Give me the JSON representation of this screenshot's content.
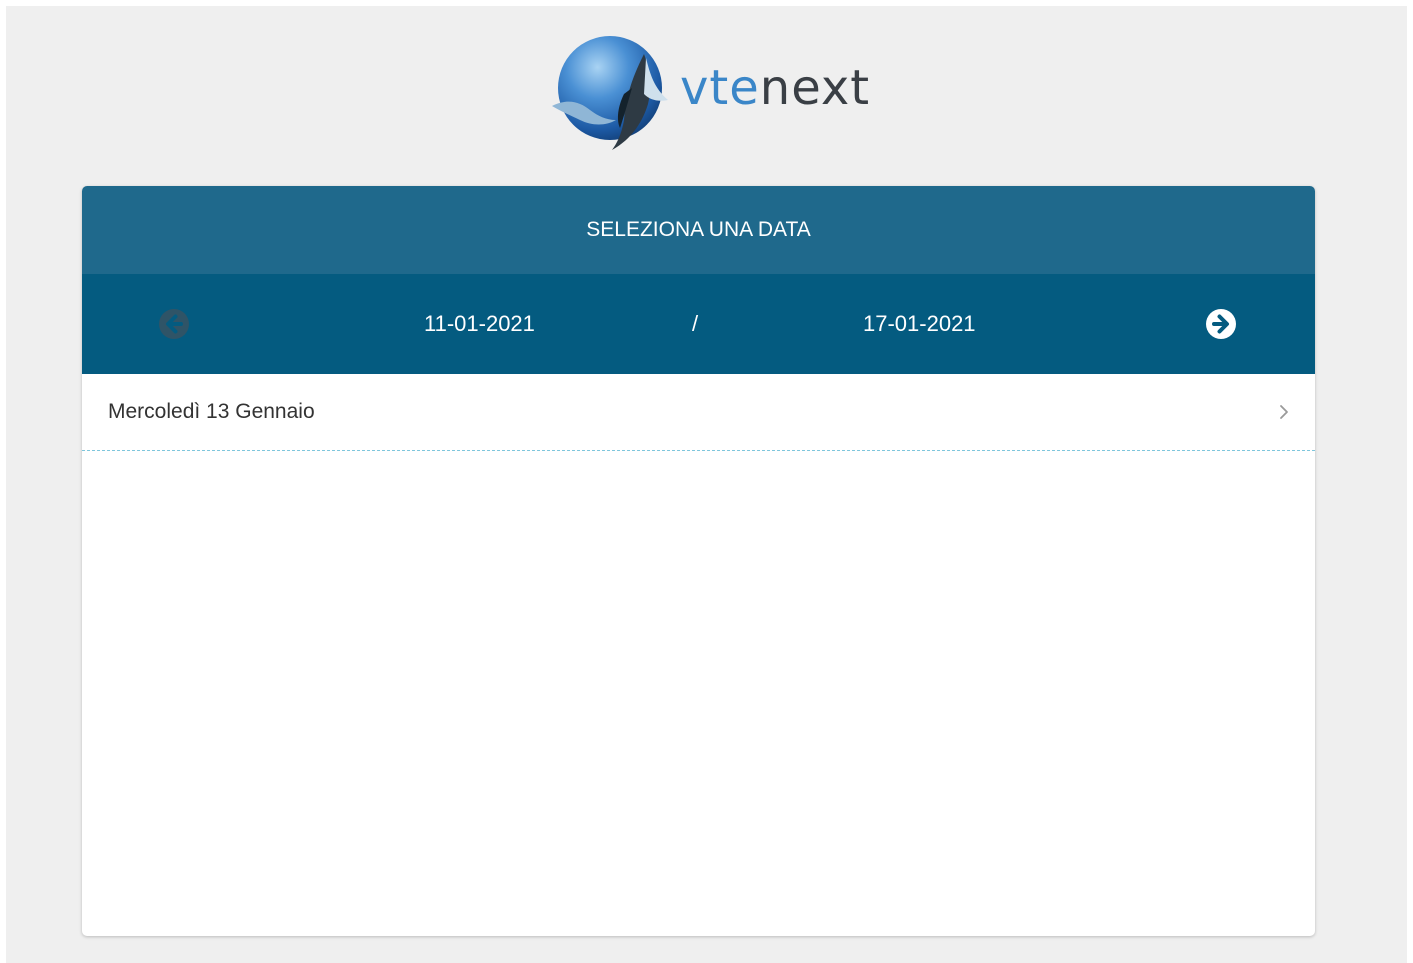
{
  "logo": {
    "text_part1": "vte",
    "text_part2": "next",
    "brand_colors": [
      "#3a86c8",
      "#3a3f45"
    ]
  },
  "header": {
    "title": "SELEZIONA UNA DATA",
    "background": "#1f698c"
  },
  "week_nav": {
    "start_date": "11-01-2021",
    "separator": "/",
    "end_date": "17-01-2021",
    "prev_icon": "arrow-circle-left-icon",
    "next_icon": "arrow-circle-right-icon",
    "prev_enabled": false,
    "background": "#045b80"
  },
  "days": [
    {
      "label": "Mercoledì 13 Gennaio",
      "icon": "chevron-right-icon"
    }
  ]
}
